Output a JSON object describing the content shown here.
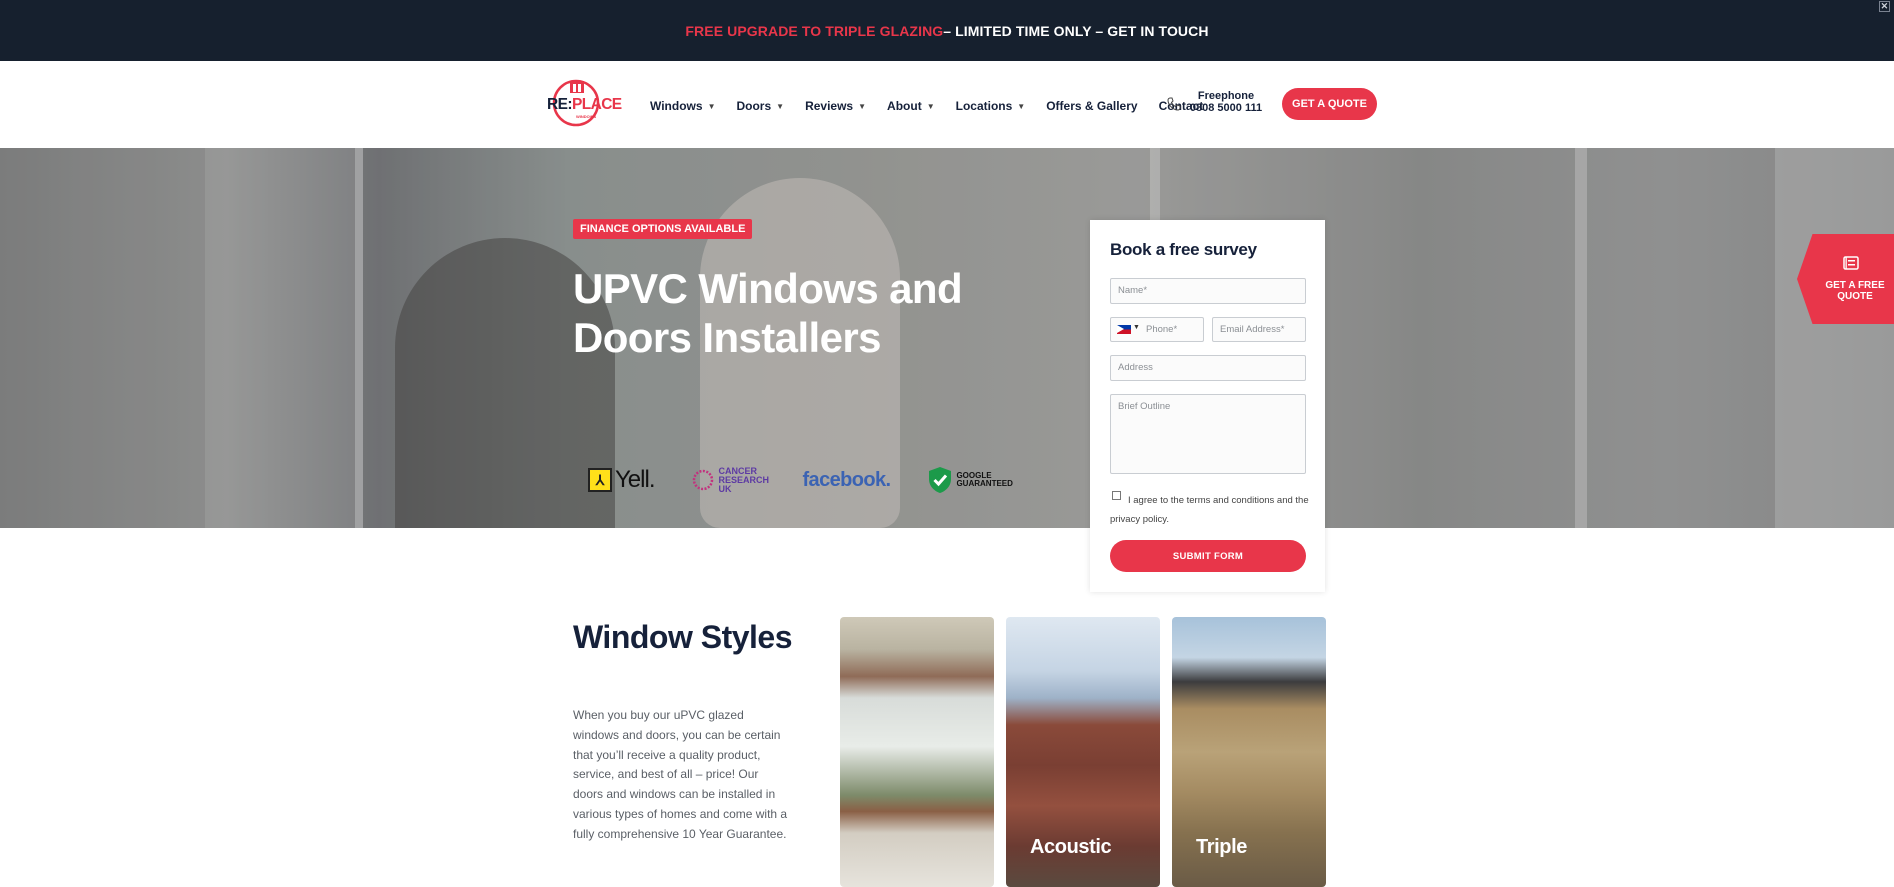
{
  "announcement": {
    "highlight": "FREE UPGRADE TO TRIPLE GLAZING",
    "rest": " – LIMITED TIME ONLY – GET IN TOUCH"
  },
  "brand": {
    "name": "RE:PLACE",
    "sub": "WINDOWS",
    "accent": "#e8364a",
    "dark": "#16202e"
  },
  "nav": {
    "items": [
      {
        "label": "Windows",
        "dropdown": true
      },
      {
        "label": "Doors",
        "dropdown": true
      },
      {
        "label": "Reviews",
        "dropdown": true
      },
      {
        "label": "About",
        "dropdown": true
      },
      {
        "label": "Locations",
        "dropdown": true
      },
      {
        "label": "Offers & Gallery",
        "dropdown": false
      },
      {
        "label": "Contact",
        "dropdown": false
      }
    ],
    "freephone_label": "Freephone",
    "freephone_number": "0808 5000 111",
    "quote_button": "GET A QUOTE"
  },
  "hero": {
    "badge": "FINANCE OPTIONS AVAILABLE",
    "title": "UPVC Windows and Doors Installers",
    "partners": {
      "yell": "Yell.",
      "cancer_research": "CANCER RESEARCH UK",
      "facebook": "facebook.",
      "google": "GOOGLE GUARANTEED"
    }
  },
  "survey": {
    "title": "Book a free survey",
    "name_placeholder": "Name*",
    "phone_placeholder": "Phone*",
    "email_placeholder": "Email Address*",
    "address_placeholder": "Address",
    "outline_placeholder": "Brief Outline",
    "agree_text": "I agree to the terms and conditions and the privacy policy.",
    "submit": "SUBMIT FORM"
  },
  "side_quote": {
    "label": "GET A FREE QUOTE"
  },
  "styles_section": {
    "title": "Window Styles",
    "body": "When you buy our uPVC glazed windows and doors, you can be certain that you’ll receive a quality product, service, and best of all – price! Our doors and windows can be installed in various types of homes and come with a fully comprehensive 10 Year Guarantee.",
    "cards": [
      {
        "label": ""
      },
      {
        "label": "Acoustic"
      },
      {
        "label": "Triple"
      }
    ]
  }
}
